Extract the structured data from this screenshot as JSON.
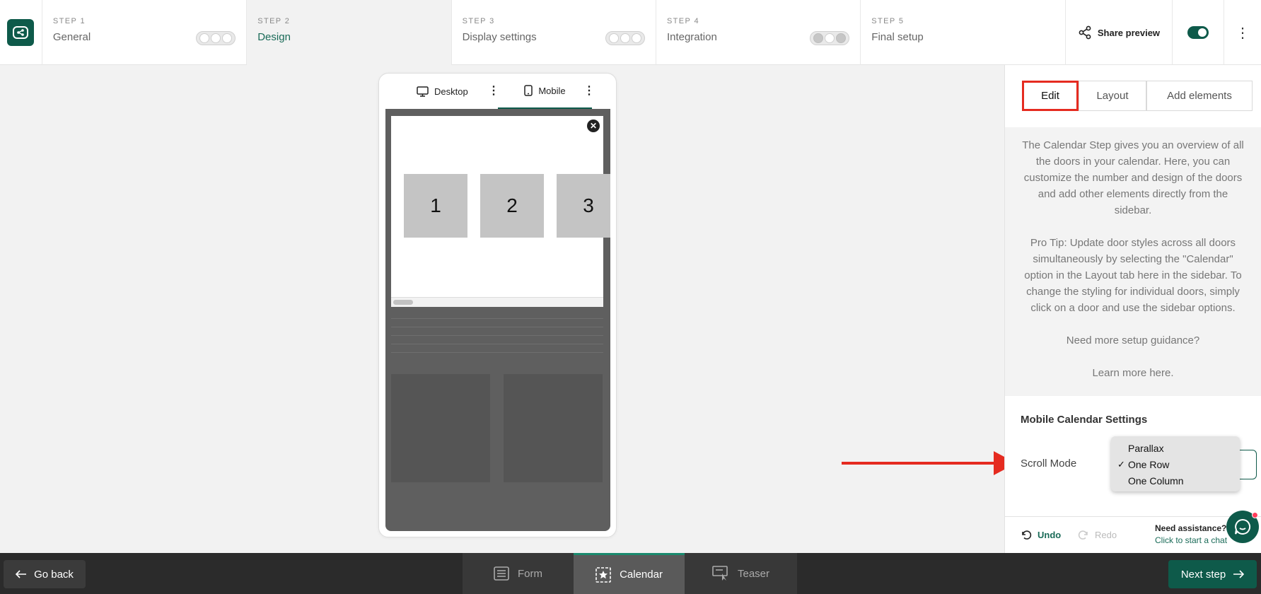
{
  "steps": [
    {
      "num": "STEP 1",
      "title": "General",
      "progress": [
        false,
        false,
        false
      ]
    },
    {
      "num": "STEP 2",
      "title": "Design"
    },
    {
      "num": "STEP 3",
      "title": "Display settings",
      "progress": [
        false,
        false,
        false
      ]
    },
    {
      "num": "STEP 4",
      "title": "Integration",
      "progress": [
        true,
        false,
        true
      ]
    },
    {
      "num": "STEP 5",
      "title": "Final setup"
    }
  ],
  "header": {
    "share_label": "Share preview",
    "toggle_on": true
  },
  "preview": {
    "tabs": {
      "desktop": "Desktop",
      "mobile": "Mobile"
    },
    "active_tab": "Mobile",
    "doors": [
      "1",
      "2",
      "3"
    ],
    "close_glyph": "✕"
  },
  "sidebar": {
    "tabs": {
      "edit": "Edit",
      "layout": "Layout",
      "add": "Add elements"
    },
    "active_tab": "Edit",
    "help": {
      "p1": "The Calendar Step gives you an overview of all the doors in your calendar. Here, you can customize the number and design of the doors and add other elements directly from the sidebar.",
      "p2": "Pro Tip: Update door styles across all doors simultaneously by selecting the \"Calendar\" option in the Layout tab here in the sidebar. To change the styling for individual doors, simply click on a door and use the sidebar options.",
      "p3": "Need more setup guidance?",
      "p4": "Learn more here."
    },
    "mobile_settings_title": "Mobile Calendar Settings",
    "scroll_mode_label": "Scroll Mode",
    "scroll_mode_options": [
      "Parallax",
      "One Row",
      "One Column"
    ],
    "scroll_mode_selected": "One Row",
    "check_glyph": "✓",
    "undo": "Undo",
    "redo": "Redo",
    "assist_title": "Need assistance?",
    "assist_sub": "Click to start a chat"
  },
  "bottom": {
    "go_back": "Go back",
    "tabs": {
      "form": "Form",
      "calendar": "Calendar",
      "teaser": "Teaser"
    },
    "active_tab": "Calendar",
    "next_step": "Next step"
  },
  "colors": {
    "brand": "#0e5a4a",
    "accent_annotation": "#e52b20"
  }
}
